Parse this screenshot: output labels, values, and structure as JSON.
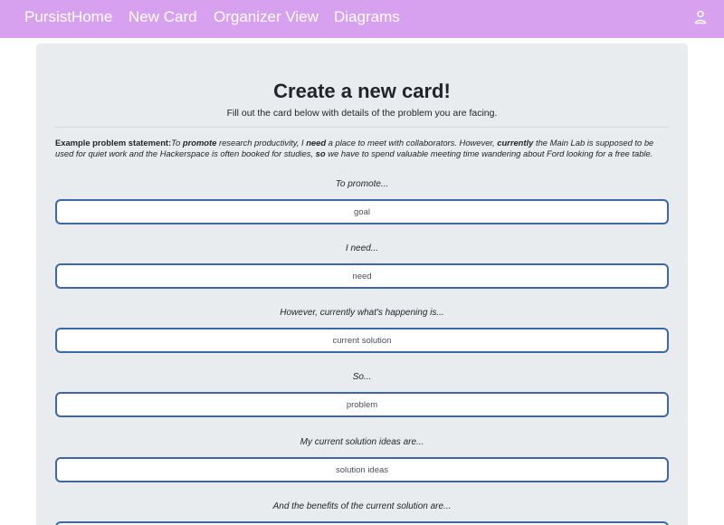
{
  "nav": {
    "links": [
      "PursistHome",
      "New Card",
      "Organizer View",
      "Diagrams"
    ],
    "user_icon": "user-icon",
    "bg_color": "#d7a1ef"
  },
  "main": {
    "title": "Create a new card!",
    "subtitle": "Fill out the card below with details of the problem you are facing.",
    "example": {
      "label": "Example problem statement:",
      "p1": "To ",
      "k1": "promote",
      "p2": " research productivity, I ",
      "k2": "need",
      "p3": " a place to meet with collaborators. However, ",
      "k3": "currently",
      "p4": " the Main Lab is supposed to be used for quiet work and the Hackerspace is often booked for studies, ",
      "k4": "so",
      "p5": " we have to spend valuable meeting time wandering about Ford looking for a free table."
    },
    "fields": [
      {
        "prompt": "To promote...",
        "placeholder": "goal"
      },
      {
        "prompt": "I need...",
        "placeholder": "need"
      },
      {
        "prompt": "However, currently what's happening is...",
        "placeholder": "current solution"
      },
      {
        "prompt": "So...",
        "placeholder": "problem"
      },
      {
        "prompt": "My current solution ideas are...",
        "placeholder": "solution ideas"
      },
      {
        "prompt": "And the benefits of the current solution are...",
        "placeholder": ""
      }
    ],
    "field_border_color": "#3f66a8"
  }
}
